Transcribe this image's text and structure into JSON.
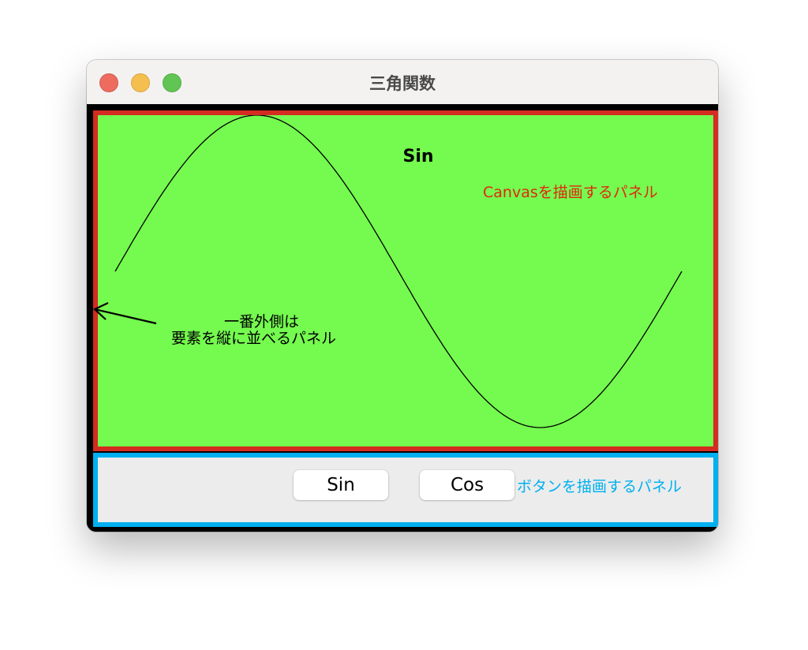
{
  "window": {
    "title": "三角関数",
    "traffic_lights": [
      "#ed6b5f",
      "#f5bf4f",
      "#61c554"
    ]
  },
  "canvas": {
    "label": "Sin",
    "function": "sin",
    "curve_color": "#000000",
    "background": "#75fa4f"
  },
  "buttons": {
    "sin_label": "Sin",
    "cos_label": "Cos"
  },
  "annotations": {
    "canvas_panel": "Canvasを描画するパネル",
    "canvas_panel_color": "#e0280f",
    "button_panel": "ボタンを描画するパネル",
    "button_panel_color": "#00b0f0",
    "outer_panel_line1": "一番外側は",
    "outer_panel_line2": "要素を縦に並べるパネル"
  }
}
